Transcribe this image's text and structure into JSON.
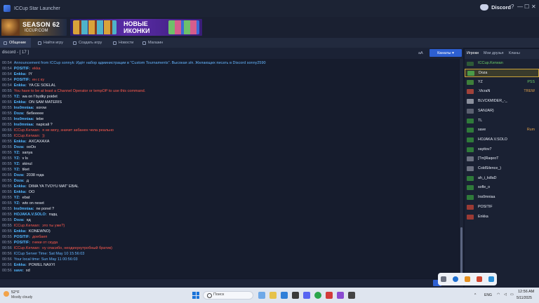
{
  "window": {
    "title": "ICCup Star Launcher"
  },
  "discord": {
    "label": "Discord",
    "help": "?",
    "minimize": "—",
    "maximize": "☐",
    "close": "✕"
  },
  "banners": {
    "season": {
      "title": "SEASON 62",
      "subtitle": "ICCUP.COM"
    },
    "icons": {
      "line1": "НОВЫЕ",
      "line2": "ИКОНКИ"
    }
  },
  "tabs": [
    "Общение",
    "Найти игру",
    "Создать игру",
    "Новости",
    "Магазин"
  ],
  "chat_header": {
    "channel": "discord - [ 17 ]",
    "font_toggle": "aA",
    "channels_button": "Каналы"
  },
  "messages": [
    {
      "time": "00:54",
      "nick": "",
      "text": "Announcement from ICCup sonnyk: Идёт набор администрации в \"Custom Tournaments\". Высокая з/п. Желающих писать в Discord sonny2590",
      "nick_style": "default",
      "text_style": "sys"
    },
    {
      "time": "00:54",
      "nick": "POSITIF:",
      "text": "ekka",
      "nick_style": "default",
      "text_style": "red"
    },
    {
      "time": "00:54",
      "nick": "Enkka:",
      "text": "IY",
      "nick_style": "default",
      "text_style": "default"
    },
    {
      "time": "00:54",
      "nick": "POSITIF:",
      "text": "ен с ку",
      "nick_style": "default",
      "text_style": "red"
    },
    {
      "time": "00:54",
      "nick": "Enkka:",
      "text": "YA CE SOELAL",
      "nick_style": "default",
      "text_style": "default"
    },
    {
      "time": "00:55",
      "nick": "",
      "text": "You have to be at least a Channel Operator or tempOP to use this command.",
      "nick_style": "default",
      "text_style": "red"
    },
    {
      "time": "00:55",
      "nick": "YZ:",
      "text": "wa on f bydky poidet",
      "nick_style": "default",
      "text_style": "default"
    },
    {
      "time": "00:55",
      "nick": "Enkka:",
      "text": "ON SAM MATERIS",
      "nick_style": "default",
      "text_style": "default"
    },
    {
      "time": "00:55",
      "nick": "Ins0mniaa:",
      "text": "xorow",
      "nick_style": "default",
      "text_style": "default"
    },
    {
      "time": "00:55",
      "nick": "Doza:",
      "text": "бебеееее",
      "nick_style": "default",
      "text_style": "default"
    },
    {
      "time": "00:55",
      "nick": "Ins0mniaa:",
      "text": "tebe",
      "nick_style": "default",
      "text_style": "default"
    },
    {
      "time": "00:55",
      "nick": "Ins0mniaa:",
      "text": "napicali ?",
      "nick_style": "default",
      "text_style": "default"
    },
    {
      "time": "00:55",
      "nick": "ICCup.Kerwan:",
      "text": "я не могу, значит забанен чела реально",
      "nick_style": "admin",
      "text_style": "red"
    },
    {
      "time": "00:55",
      "nick": "ICCup.Kerwan:",
      "text": "))",
      "nick_style": "admin",
      "text_style": "red"
    },
    {
      "time": "00:55",
      "nick": "Enkka:",
      "text": "AXCAXAXA",
      "nick_style": "default",
      "text_style": "default"
    },
    {
      "time": "00:55",
      "nick": "Doza:",
      "text": "ooOo",
      "nick_style": "default",
      "text_style": "default"
    },
    {
      "time": "00:55",
      "nick": "YZ:",
      "text": "sanya",
      "nick_style": "default",
      "text_style": "default"
    },
    {
      "time": "00:55",
      "nick": "YZ:",
      "text": "v ls",
      "nick_style": "default",
      "text_style": "default"
    },
    {
      "time": "00:55",
      "nick": "YZ:",
      "text": "skinul",
      "nick_style": "default",
      "text_style": "default"
    },
    {
      "time": "00:55",
      "nick": "YZ:",
      "text": "tiket",
      "nick_style": "default",
      "text_style": "default"
    },
    {
      "time": "00:55",
      "nick": "Doza:",
      "text": "2038 года",
      "nick_style": "default",
      "text_style": "default"
    },
    {
      "time": "00:55",
      "nick": "Doza:",
      "text": "д",
      "nick_style": "default",
      "text_style": "default"
    },
    {
      "time": "00:55",
      "nick": "Enkka:",
      "text": "DIMA YA TVOYU MAT' EBAL",
      "nick_style": "default",
      "text_style": "default"
    },
    {
      "time": "00:55",
      "nick": "Enkka:",
      "text": "OO",
      "nick_style": "default",
      "text_style": "default"
    },
    {
      "time": "00:55",
      "nick": "YZ:",
      "text": "ebat",
      "nick_style": "default",
      "text_style": "default"
    },
    {
      "time": "00:55",
      "nick": "YZ:",
      "text": "wto on neset",
      "nick_style": "default",
      "text_style": "default"
    },
    {
      "time": "00:55",
      "nick": "Ins0mniaa:",
      "text": "ne ponel ?",
      "nick_style": "default",
      "text_style": "default"
    },
    {
      "time": "00:55",
      "nick": "HOJAKA.V.SOLO:",
      "text": "пздц",
      "nick_style": "default",
      "text_style": "default"
    },
    {
      "time": "00:55",
      "nick": "Doza:",
      "text": "хд",
      "nick_style": "default",
      "text_style": "default"
    },
    {
      "time": "00:55",
      "nick": "ICCup.Kerwan:",
      "text": "это ты уже?)",
      "nick_style": "admin",
      "text_style": "red"
    },
    {
      "time": "00:55",
      "nick": "Enkka:",
      "text": "KONEWNO)",
      "nick_style": "default",
      "text_style": "default"
    },
    {
      "time": "00:55",
      "nick": "POSITIF:",
      "text": "доебаеп",
      "nick_style": "default",
      "text_style": "red"
    },
    {
      "time": "00:55",
      "nick": "POSITIF:",
      "text": "гнеки от скуда",
      "nick_style": "default",
      "text_style": "red"
    },
    {
      "time": "00:56",
      "nick": "ICCup.Kerwan:",
      "text": "ну спасибо, неодинукутробный братик)",
      "nick_style": "admin",
      "text_style": "red"
    },
    {
      "time": "00:56",
      "nick": "",
      "text": "ICCup Server Time: Sat May 10 15:56:03",
      "nick_style": "default",
      "text_style": "sys"
    },
    {
      "time": "00:56",
      "nick": "",
      "text": "Your local time: Sun May 11 00:56:03",
      "nick_style": "default",
      "text_style": "sys"
    },
    {
      "time": "00:56",
      "nick": "Enkka:",
      "text": "POWEL NAXYI",
      "nick_style": "default",
      "text_style": "default"
    },
    {
      "time": "00:56",
      "nick": "save:",
      "text": "xd",
      "nick_style": "default",
      "text_style": "default"
    }
  ],
  "users_tabs": [
    "Игроки",
    "Мои друзья",
    "Кланы"
  ],
  "users_header": "ICCup.Kerwan",
  "users": [
    {
      "name": "Doza",
      "status": "",
      "selected": true,
      "color": "#4b9b48"
    },
    {
      "name": "YZ",
      "status": "PSS",
      "selected": false,
      "color": "#3e7f3a"
    },
    {
      "name": ".VicraN",
      "status": "TREW",
      "selected": false,
      "color": "#a0423a"
    },
    {
      "name": "BLVCKMIDER_-_",
      "status": "",
      "selected": false,
      "color": "#8a8f9c"
    },
    {
      "name": "SANJAR)",
      "status": "",
      "selected": false,
      "color": "#5b6070"
    },
    {
      "name": "TL",
      "status": "",
      "selected": false,
      "color": "#2f7a3a"
    },
    {
      "name": "save",
      "status": "Rum",
      "selected": false,
      "color": "#2f7a3a"
    },
    {
      "name": "HOJAKA.V.SOLO",
      "status": "",
      "selected": false,
      "color": "#2f7a3a"
    },
    {
      "name": "xayitov7",
      "status": "",
      "selected": false,
      "color": "#2f7a3a"
    },
    {
      "name": "[Tm]RaqeoT",
      "status": "",
      "selected": false,
      "color": "#6b7080"
    },
    {
      "name": "ColdSilence_)",
      "status": "",
      "selected": false,
      "color": "#6b7080"
    },
    {
      "name": "ah_i_kdlaD",
      "status": "",
      "selected": false,
      "color": "#2f7a3a"
    },
    {
      "name": "sofle_o",
      "status": "",
      "selected": false,
      "color": "#2f7a3a"
    },
    {
      "name": "Ins0mniaa",
      "status": "",
      "selected": false,
      "color": "#2f7a3a"
    },
    {
      "name": "POSITIF",
      "status": "",
      "selected": false,
      "color": "#9a3a34"
    },
    {
      "name": "Enkka",
      "status": "",
      "selected": false,
      "color": "#9a3a34"
    }
  ],
  "taskbar": {
    "weather_temp": "52°F",
    "weather_desc": "Mostly cloudy",
    "search_placeholder": "Поиск",
    "lang": "ENG",
    "time": "12:56 AM",
    "date": "5/11/2025"
  }
}
